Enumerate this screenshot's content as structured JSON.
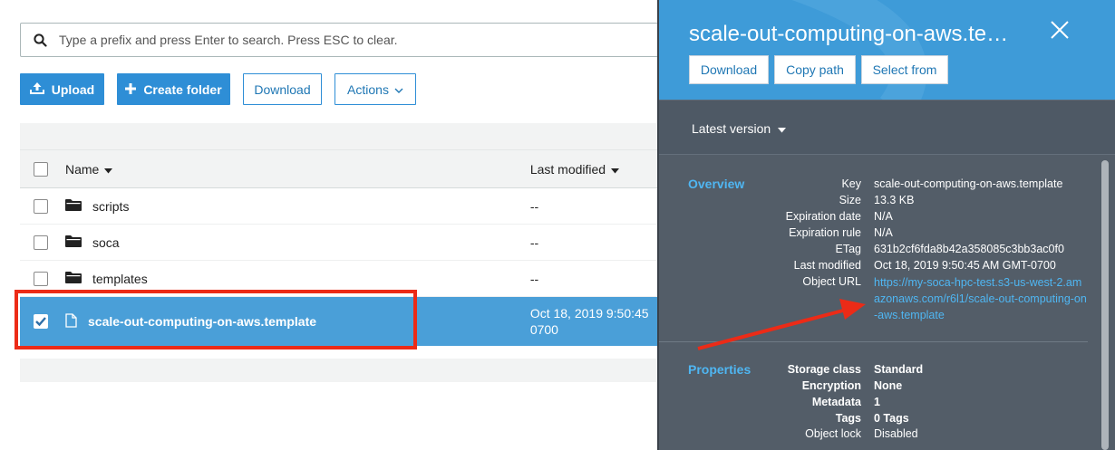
{
  "search": {
    "placeholder": "Type a prefix and press Enter to search. Press ESC to clear."
  },
  "toolbar": {
    "upload_label": "Upload",
    "create_folder_label": "Create folder",
    "download_label": "Download",
    "actions_label": "Actions"
  },
  "table": {
    "columns": {
      "name": "Name",
      "last_modified": "Last modified"
    },
    "rows": [
      {
        "name": "scripts",
        "last_modified": "--",
        "type": "folder"
      },
      {
        "name": "soca",
        "last_modified": "--",
        "type": "folder"
      },
      {
        "name": "templates",
        "last_modified": "--",
        "type": "folder"
      },
      {
        "name": "scale-out-computing-on-aws.template",
        "last_modified_line1": "Oct 18, 2019 9:50:45",
        "last_modified_line2": "0700",
        "type": "file",
        "selected": true
      }
    ]
  },
  "panel": {
    "title": "scale-out-computing-on-aws.te…",
    "buttons": {
      "download": "Download",
      "copy_path": "Copy path",
      "select_from": "Select from"
    },
    "version": "Latest version",
    "overview": {
      "title": "Overview",
      "key_label": "Key",
      "key": "scale-out-computing-on-aws.template",
      "size_label": "Size",
      "size": "13.3 KB",
      "expiration_date_label": "Expiration date",
      "expiration_date": "N/A",
      "expiration_rule_label": "Expiration rule",
      "expiration_rule": "N/A",
      "etag_label": "ETag",
      "etag": "631b2cf6fda8b42a358085c3bb3ac0f0",
      "last_modified_label": "Last modified",
      "last_modified": "Oct 18, 2019 9:50:45 AM GMT-0700",
      "object_url_label": "Object URL",
      "object_url": "https://my-soca-hpc-test.s3-us-west-2.amazonaws.com/r6l1/scale-out-computing-on-aws.template"
    },
    "properties": {
      "title": "Properties",
      "storage_class_label": "Storage class",
      "storage_class": "Standard",
      "encryption_label": "Encryption",
      "encryption": "None",
      "metadata_label": "Metadata",
      "metadata": "1",
      "tags_label": "Tags",
      "tags": "0 Tags",
      "object_lock_label": "Object lock",
      "object_lock": "Disabled"
    }
  },
  "colors": {
    "accent": "#2e8ed6",
    "selected_row": "#4a9fd8",
    "panel_bg": "#535d68",
    "link": "#4fb6f2",
    "annotation": "#ec2b17"
  }
}
